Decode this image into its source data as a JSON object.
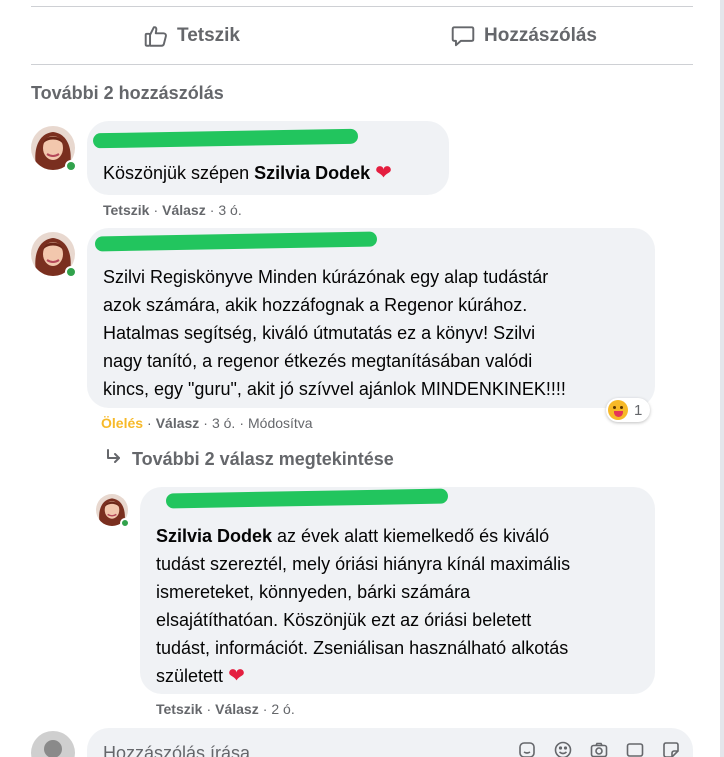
{
  "actions": {
    "like_label": "Tetszik",
    "comment_label": "Hozzászólás"
  },
  "more_comments": "További 2 hozzászólás",
  "comments": [
    {
      "text_before": "Köszönjük szépen ",
      "mention": "Szilvia Dodek",
      "reaction_link": "Tetszik",
      "reply_link": "Válasz",
      "time": "3 ó."
    },
    {
      "lines": [
        "Szilvi Regiskönyve Minden kúrázónak egy alap tudástár",
        "azok számára, akik hozzáfognak a Regenor kúrához.",
        "Hatalmas segítség, kiváló útmutatás ez a könyv! Szilvi",
        "nagy tanító, a regenor étkezés megtanításában valódi",
        "kincs, egy \"guru\", akit jó szívvel ajánlok MINDENKINEK!!!!"
      ],
      "reaction_link": "Ölelés",
      "reply_link": "Válasz",
      "time": "3 ó.",
      "edited": "Módosítva",
      "reaction_count": "1"
    }
  ],
  "view_replies": "További 2 válasz megtekintése",
  "reply": {
    "mention": "Szilvia Dodek",
    "line1_rest": " az évek alatt kiemelkedő és kiváló",
    "lines": [
      "tudást szereztél, mely óriási hiányra kínál maximális",
      "ismereteket, könnyeden, bárki számára",
      "elsajátíthatóan. Köszönjük ezt az óriási beletett",
      "tudást, információt. Zseniálisan használható alkotás",
      "született"
    ],
    "reaction_link": "Tetszik",
    "reply_link": "Válasz",
    "time": "2 ó."
  },
  "composer": {
    "placeholder": "Hozzászólás írása..."
  },
  "colors": {
    "bubble": "#f0f2f5",
    "secondary_text": "#65676b",
    "heart": "#e41e3f",
    "care_reaction": "#f7b928",
    "online": "#31a24c",
    "redaction": "#22c55e"
  },
  "icons": [
    "thumbs-up-icon",
    "comment-icon",
    "reply-arrow-icon",
    "heart-icon",
    "care-emoji-icon",
    "sticker-icon",
    "emoji-icon",
    "camera-icon",
    "gif-icon",
    "sticker-face-icon"
  ]
}
